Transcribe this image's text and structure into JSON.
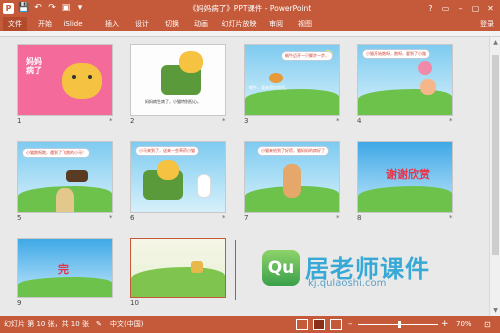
{
  "window": {
    "title": "《妈妈病了》PPT课件 - PowerPoint",
    "app_letter": "P",
    "controls": [
      "?",
      "▭",
      "–",
      "▢",
      "✕"
    ]
  },
  "quick_access": [
    "💾",
    "↶",
    "↷",
    "▣",
    "▾"
  ],
  "tabs": [
    {
      "label": "文件"
    },
    {
      "label": "开始"
    },
    {
      "label": "iSlide"
    },
    {
      "label": "插入"
    },
    {
      "label": "设计"
    },
    {
      "label": "切换"
    },
    {
      "label": "动画"
    },
    {
      "label": "幻灯片放映"
    },
    {
      "label": "审阅"
    },
    {
      "label": "视图"
    }
  ],
  "login_label": "登录",
  "slides": [
    {
      "number": "1",
      "title_text": "妈妈病了",
      "star": "*"
    },
    {
      "number": "2",
      "caption": "妈妈病生病了，小猫特别担心。",
      "star": "*"
    },
    {
      "number": "3",
      "bubble": "蜗牛迈开一只脚步一步，",
      "caption": "蜗牛，我来帮你找药。",
      "star": "*"
    },
    {
      "number": "4",
      "bubble": "小猫开始跑呀，跑呀，要到了小路",
      "star": "*"
    },
    {
      "number": "5",
      "bubble": "小猫跑呀跑，遇到了飞跑的小马！",
      "star": "*"
    },
    {
      "number": "6",
      "bubble": "小马来到了，送来一些草药小猫",
      "star": "*"
    },
    {
      "number": "7",
      "bubble": "小猫来给到了好药，猫妈妈的病好了",
      "star": "*"
    },
    {
      "number": "8",
      "thanks": "谢谢欣赏",
      "star": "*"
    },
    {
      "number": "9",
      "end_char": "完",
      "star": ""
    },
    {
      "number": "10",
      "star": ""
    }
  ],
  "watermark": {
    "icon_text": "Qu",
    "text": "居老师课件",
    "url": "kj.qulaoshi.com"
  },
  "status": {
    "slide_info": "幻灯片 第 10 张，共 10 张",
    "language": "中文(中国)",
    "zoom": "70%",
    "zoom_minus": "–",
    "zoom_plus": "+"
  },
  "colors": {
    "accent": "#c55a3a",
    "watermark_blue": "#36a9d6",
    "watermark_green": "#3aa04a"
  }
}
